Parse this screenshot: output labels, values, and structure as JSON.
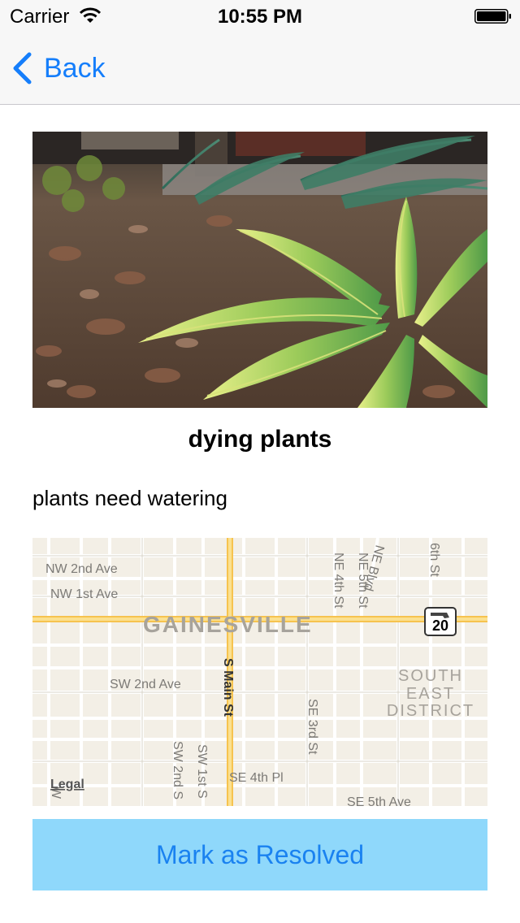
{
  "status_bar": {
    "carrier": "Carrier",
    "time": "10:55 PM"
  },
  "nav": {
    "back_label": "Back"
  },
  "report": {
    "title": "dying plants",
    "description": "plants need watering"
  },
  "map": {
    "city_label": "GAINESVILLE",
    "district_label": [
      "SOUTH",
      "EAST",
      "DISTRICT"
    ],
    "route_shield": "20",
    "legal": "Legal",
    "streets": {
      "nw2": "NW 2nd Ave",
      "nw1": "NW 1st Ave",
      "sw2ave": "SW 2nd Ave",
      "smain": "S Main St",
      "ne4": "NE 4th St",
      "ne5": "NE 5th St",
      "neblvd": "NE Blvd",
      "sixth": "6th St",
      "se3": "SE 3rd St",
      "se4pl": "SE 4th Pl",
      "sw2st": "SW 2nd S",
      "sw1st": "SW 1st S",
      "se5ave": "SE 5th Ave",
      "sw_edge": "W"
    }
  },
  "actions": {
    "resolve_label": "Mark as Resolved"
  },
  "colors": {
    "accent": "#157efb",
    "button_bg": "#8fd8fb",
    "button_text": "#1a82f0"
  }
}
